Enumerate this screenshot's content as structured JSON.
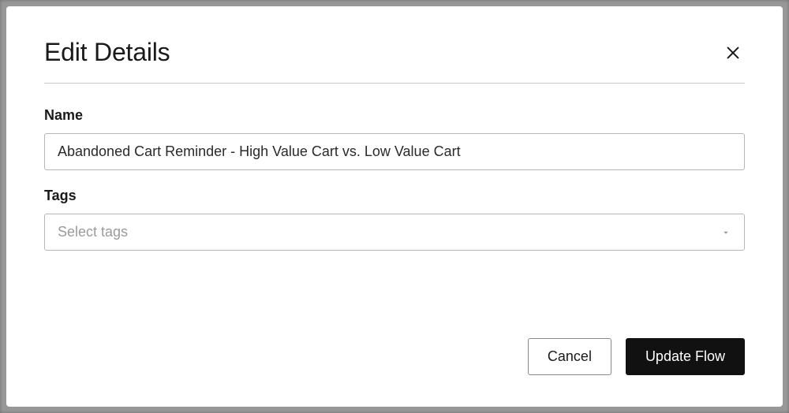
{
  "modal": {
    "title": "Edit Details",
    "fields": {
      "name": {
        "label": "Name",
        "value": "Abandoned Cart Reminder - High Value Cart vs. Low Value Cart"
      },
      "tags": {
        "label": "Tags",
        "placeholder": "Select tags"
      }
    },
    "buttons": {
      "cancel": "Cancel",
      "submit": "Update Flow"
    }
  }
}
